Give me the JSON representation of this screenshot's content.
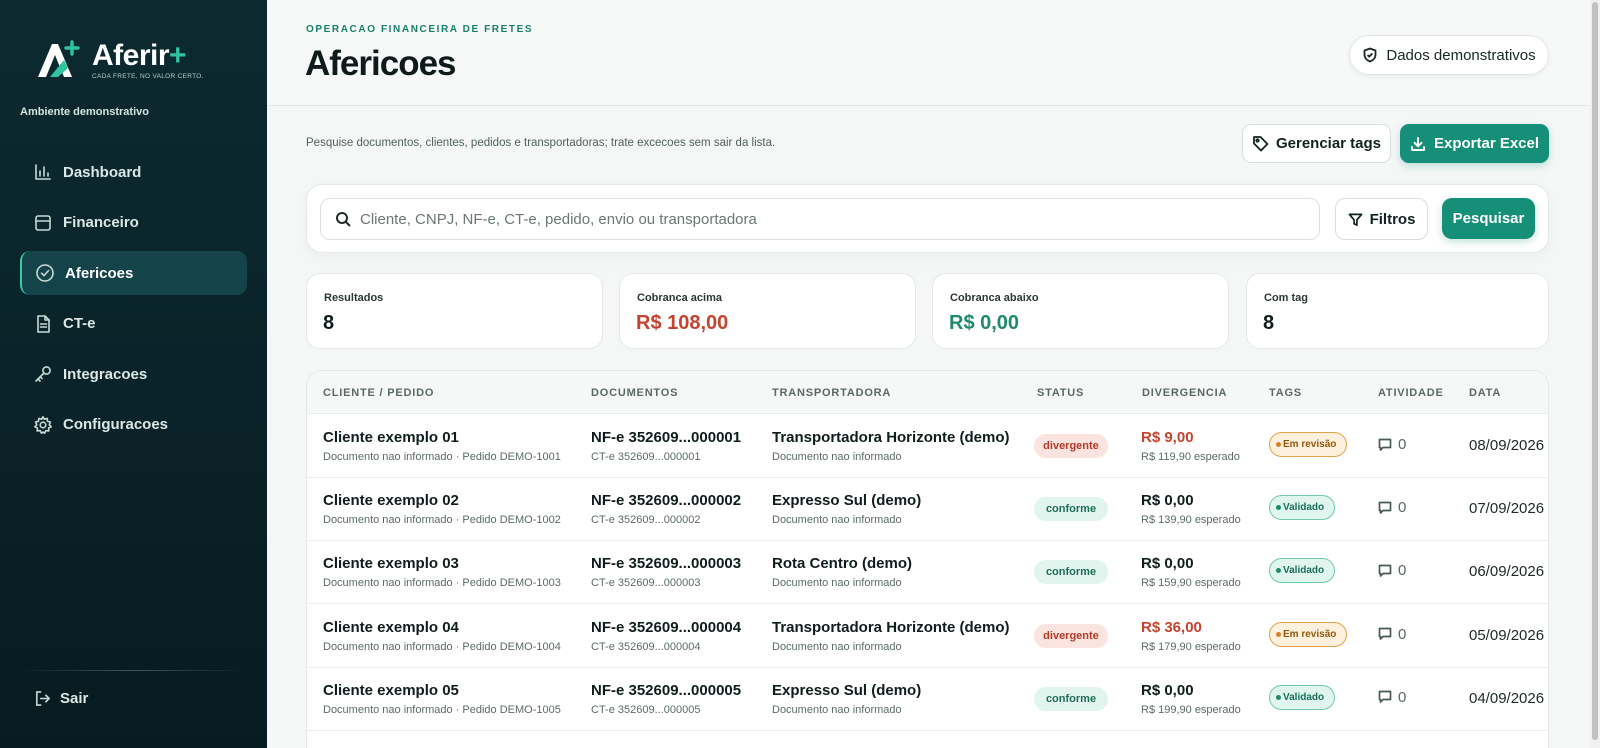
{
  "sidebar": {
    "brand": {
      "name": "Aferir",
      "plus": "+",
      "tagline": "CADA FRETE, NO VALOR CERTO."
    },
    "environment": "Ambiente demonstrativo",
    "items": [
      {
        "label": "Dashboard",
        "icon": "bar-chart-icon"
      },
      {
        "label": "Financeiro",
        "icon": "archive-icon"
      },
      {
        "label": "Afericoes",
        "icon": "check-circle-icon",
        "active": true
      },
      {
        "label": "CT-e",
        "icon": "document-icon"
      },
      {
        "label": "Integracoes",
        "icon": "key-icon"
      },
      {
        "label": "Configuracoes",
        "icon": "gear-icon"
      }
    ],
    "logout": "Sair"
  },
  "header": {
    "eyebrow": "OPERACAO FINANCEIRA DE FRETES",
    "title": "Afericoes",
    "demo_badge": "Dados demonstrativos"
  },
  "toolbar": {
    "subtitle": "Pesquise documentos, clientes, pedidos e transportadoras; trate excecoes sem sair da lista.",
    "manage_tags": "Gerenciar tags",
    "export_excel": "Exportar Excel"
  },
  "search": {
    "placeholder": "Cliente, CNPJ, NF-e, CT-e, pedido, envio ou transportadora",
    "value": "",
    "filters_label": "Filtros",
    "search_label": "Pesquisar"
  },
  "stats": [
    {
      "label": "Resultados",
      "value": "8",
      "tone": "neutral"
    },
    {
      "label": "Cobranca acima",
      "value": "R$ 108,00",
      "tone": "red"
    },
    {
      "label": "Cobranca abaixo",
      "value": "R$ 0,00",
      "tone": "green"
    },
    {
      "label": "Com tag",
      "value": "8",
      "tone": "neutral"
    }
  ],
  "table": {
    "columns": [
      "CLIENTE / PEDIDO",
      "DOCUMENTOS",
      "TRANSPORTADORA",
      "STATUS",
      "DIVERGENCIA",
      "TAGS",
      "ATIVIDADE",
      "DATA"
    ],
    "rows": [
      {
        "client": "Cliente exemplo 01",
        "client_sub": "Documento nao informado · Pedido DEMO-1001",
        "nfe": "NF-e 352609...000001",
        "cte": "CT-e 352609...000001",
        "carrier": "Transportadora Horizonte (demo)",
        "carrier_sub": "Documento nao informado",
        "status": "divergente",
        "divergence": "R$ 9,00",
        "expected": "R$ 119,90 esperado",
        "tag": "Em revisão",
        "tag_type": "review",
        "activity": "0",
        "date": "08/09/2026"
      },
      {
        "client": "Cliente exemplo 02",
        "client_sub": "Documento nao informado · Pedido DEMO-1002",
        "nfe": "NF-e 352609...000002",
        "cte": "CT-e 352609...000002",
        "carrier": "Expresso Sul (demo)",
        "carrier_sub": "Documento nao informado",
        "status": "conforme",
        "divergence": "R$ 0,00",
        "expected": "R$ 139,90 esperado",
        "tag": "Validado",
        "tag_type": "valid",
        "activity": "0",
        "date": "07/09/2026"
      },
      {
        "client": "Cliente exemplo 03",
        "client_sub": "Documento nao informado · Pedido DEMO-1003",
        "nfe": "NF-e 352609...000003",
        "cte": "CT-e 352609...000003",
        "carrier": "Rota Centro (demo)",
        "carrier_sub": "Documento nao informado",
        "status": "conforme",
        "divergence": "R$ 0,00",
        "expected": "R$ 159,90 esperado",
        "tag": "Validado",
        "tag_type": "valid",
        "activity": "0",
        "date": "06/09/2026"
      },
      {
        "client": "Cliente exemplo 04",
        "client_sub": "Documento nao informado · Pedido DEMO-1004",
        "nfe": "NF-e 352609...000004",
        "cte": "CT-e 352609...000004",
        "carrier": "Transportadora Horizonte (demo)",
        "carrier_sub": "Documento nao informado",
        "status": "divergente",
        "divergence": "R$ 36,00",
        "expected": "R$ 179,90 esperado",
        "tag": "Em revisão",
        "tag_type": "review",
        "activity": "0",
        "date": "05/09/2026"
      },
      {
        "client": "Cliente exemplo 05",
        "client_sub": "Documento nao informado · Pedido DEMO-1005",
        "nfe": "NF-e 352609...000005",
        "cte": "CT-e 352609...000005",
        "carrier": "Expresso Sul (demo)",
        "carrier_sub": "Documento nao informado",
        "status": "conforme",
        "divergence": "R$ 0,00",
        "expected": "R$ 199,90 esperado",
        "tag": "Validado",
        "tag_type": "valid",
        "activity": "0",
        "date": "04/09/2026"
      }
    ]
  },
  "colors": {
    "accent": "#168f78",
    "sidebar_bg": "#0c2a30",
    "danger": "#c4442f",
    "success": "#1f8a6d"
  }
}
